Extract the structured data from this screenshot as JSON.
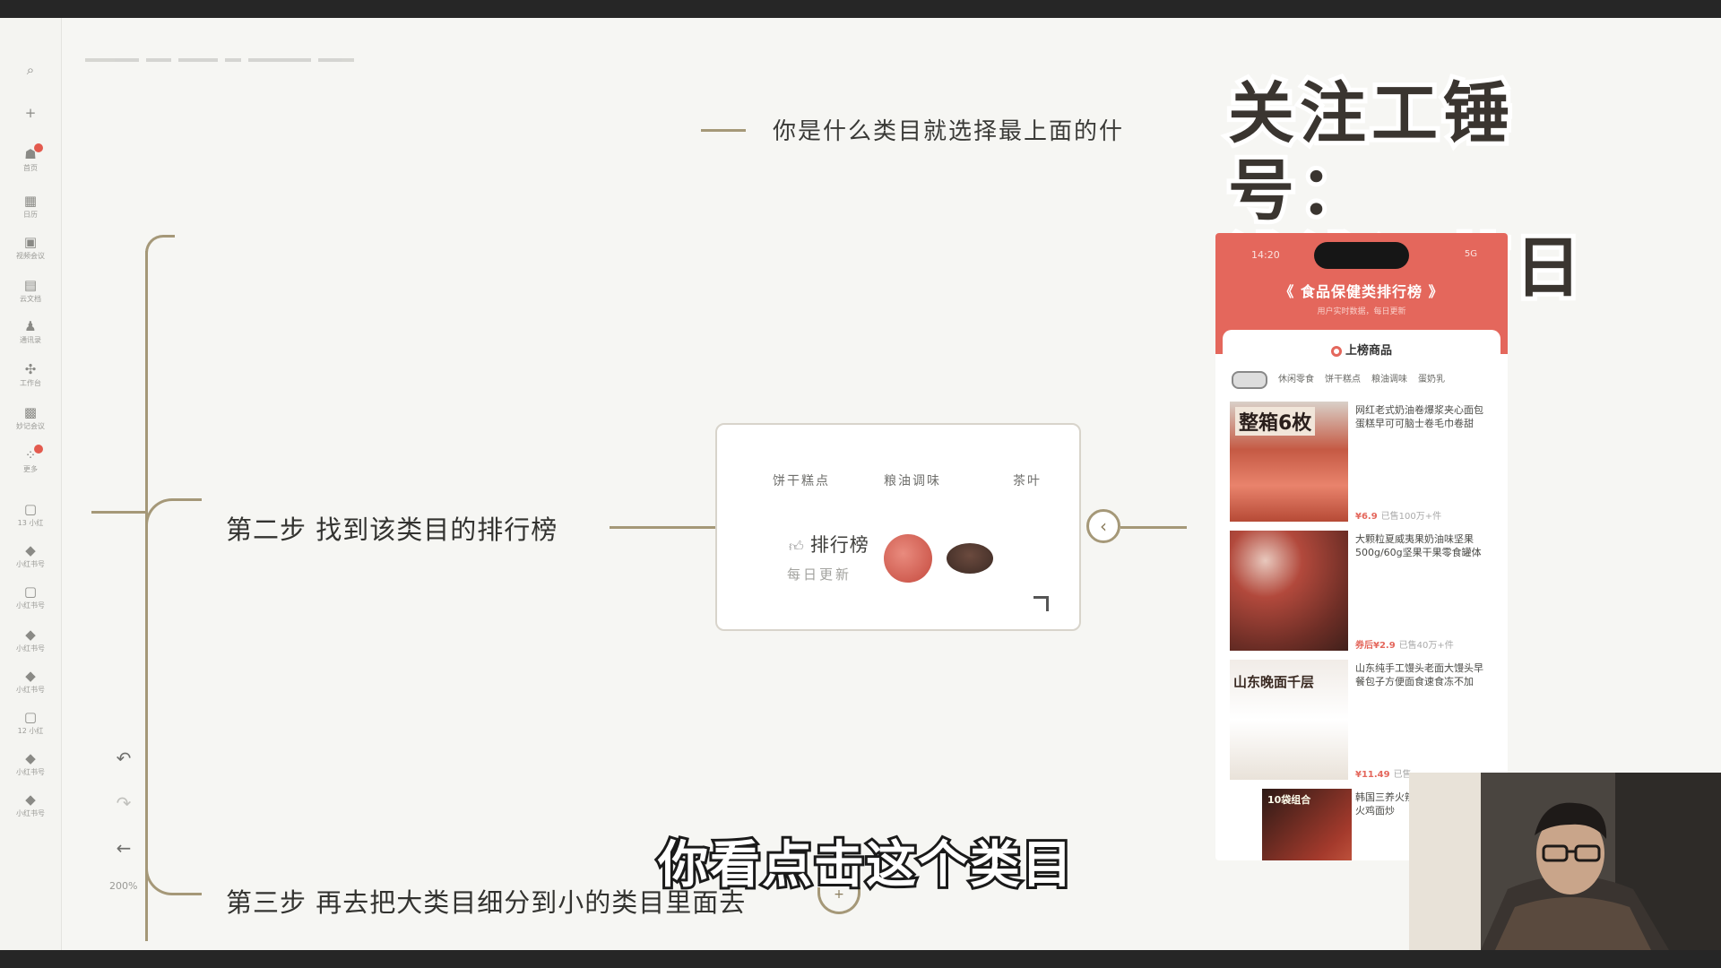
{
  "sidebar": {
    "items": [
      {
        "icon": "search-icon",
        "glyph": "⌕",
        "label": ""
      },
      {
        "icon": "plus-icon",
        "glyph": "+",
        "label": ""
      },
      {
        "icon": "home-icon",
        "glyph": "☗",
        "label": "首页",
        "badge": true
      },
      {
        "icon": "calendar-icon",
        "glyph": "▦",
        "label": "日历"
      },
      {
        "icon": "video-meeting-icon",
        "glyph": "▣",
        "label": "视频会议"
      },
      {
        "icon": "document-icon",
        "glyph": "▤",
        "label": "云文档"
      },
      {
        "icon": "contacts-icon",
        "glyph": "♟",
        "label": "通讯录"
      },
      {
        "icon": "workspace-icon",
        "glyph": "✣",
        "label": "工作台"
      },
      {
        "icon": "app-icon",
        "glyph": "▩",
        "label": "妙记会议"
      },
      {
        "icon": "more-icon",
        "glyph": "⁘",
        "label": "更多",
        "badge": true
      },
      {
        "icon": "chat-icon",
        "glyph": "▢",
        "label": "13 小红"
      },
      {
        "icon": "chat-icon",
        "glyph": "◆",
        "label": "小红书号"
      },
      {
        "icon": "chat-icon",
        "glyph": "▢",
        "label": "小红书号"
      },
      {
        "icon": "chat-icon",
        "glyph": "◆",
        "label": "小红书号"
      },
      {
        "icon": "chat-icon",
        "glyph": "◆",
        "label": "小红书号"
      },
      {
        "icon": "chat-icon",
        "glyph": "▢",
        "label": "12 小红"
      },
      {
        "icon": "chat-icon",
        "glyph": "◆",
        "label": "小红书号"
      },
      {
        "icon": "chat-icon",
        "glyph": "◆",
        "label": "小红书号"
      }
    ]
  },
  "mindmap": {
    "top_partial_text": "你是什么类目就选择最上面的什",
    "step2": "第二步 找到该类目的排行榜",
    "step3": "第三步 再去把大类目细分到小的类目里面去",
    "card": {
      "tabs": [
        "饼干糕点",
        "粮油调味",
        "茶叶"
      ],
      "rank_title": "排行榜",
      "rank_sub": "每日更新"
    },
    "collapse_glyph": "‹",
    "add_glyph": "+"
  },
  "toolbar": {
    "undo": "↶",
    "redo": "↷",
    "back": "←",
    "zoom": "200%"
  },
  "brand": {
    "line1": "关注工锤号：",
    "line2": "浅浅运营日记"
  },
  "phone": {
    "time": "14:20",
    "signal": "5G",
    "title": "《 食品保健类排行榜 》",
    "subtitle": "用户实时数据，每日更新",
    "on_list": "上榜商品",
    "categories": [
      "休闲零食",
      "饼干糕点",
      "粮油调味",
      "蛋奶乳"
    ],
    "products": [
      {
        "desc": "网红老式奶油卷爆浆夹心面包蛋糕早可可脑士卷毛巾卷甜",
        "price": "¥6.9",
        "sold": "已售100万+件",
        "banner": "整箱6枚"
      },
      {
        "desc": "大颗粒夏威夷果奶油味坚果500g/60g坚果干果零食罐体",
        "price": "券后¥2.9",
        "sold": "已售40万+件",
        "banner": ""
      },
      {
        "desc": "山东纯手工馒头老面大馒头早餐包子方便面食速食冻不加",
        "price": "¥11.49",
        "sold": "已售",
        "banner": "山东晚面千层"
      },
      {
        "desc": "韩国三养火辣火鸡面炒",
        "price": "",
        "sold": "",
        "banner": "10袋组合"
      }
    ]
  },
  "caption": "你看点击这个类目"
}
